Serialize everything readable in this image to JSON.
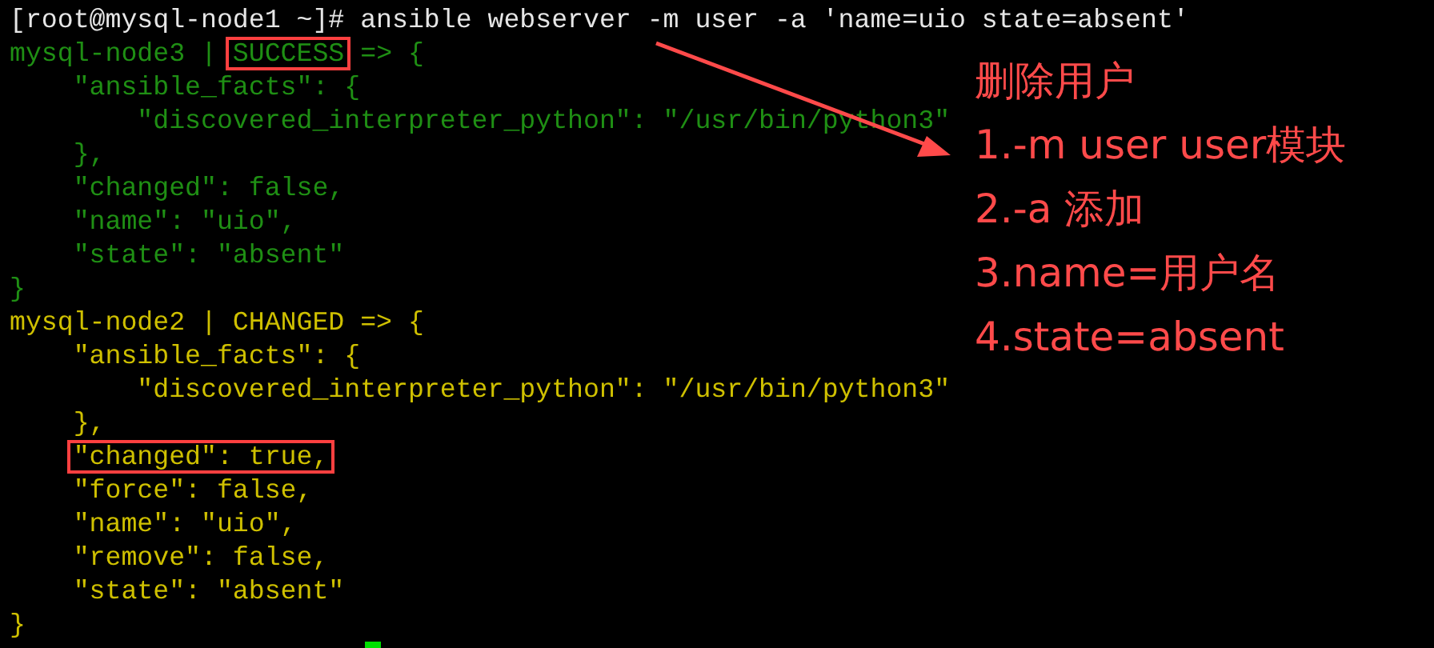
{
  "terminal": {
    "lines": [
      {
        "kind": "prompt",
        "parts": [
          {
            "text": "[root@mysql-node1 ~]# ansible webserver -m user -a 'name=uio state=absent'",
            "boxed": false
          }
        ]
      },
      {
        "kind": "success",
        "parts": [
          {
            "text": "mysql-node3 | ",
            "boxed": false
          },
          {
            "text": "SUCCESS",
            "boxed": true
          },
          {
            "text": " => {",
            "boxed": false
          }
        ]
      },
      {
        "kind": "success",
        "parts": [
          {
            "text": "    \"ansible_facts\": {",
            "boxed": false
          }
        ]
      },
      {
        "kind": "success",
        "parts": [
          {
            "text": "        \"discovered_interpreter_python\": \"/usr/bin/python3\"",
            "boxed": false
          }
        ]
      },
      {
        "kind": "success",
        "parts": [
          {
            "text": "    },",
            "boxed": false
          }
        ]
      },
      {
        "kind": "success",
        "parts": [
          {
            "text": "    \"changed\": false,",
            "boxed": false
          }
        ]
      },
      {
        "kind": "success",
        "parts": [
          {
            "text": "    \"name\": \"uio\",",
            "boxed": false
          }
        ]
      },
      {
        "kind": "success",
        "parts": [
          {
            "text": "    \"state\": \"absent\"",
            "boxed": false
          }
        ]
      },
      {
        "kind": "success",
        "parts": [
          {
            "text": "}",
            "boxed": false
          }
        ]
      },
      {
        "kind": "changed",
        "parts": [
          {
            "text": "mysql-node2 | CHANGED => {",
            "boxed": false
          }
        ]
      },
      {
        "kind": "changed",
        "parts": [
          {
            "text": "    \"ansible_facts\": {",
            "boxed": false
          }
        ]
      },
      {
        "kind": "changed",
        "parts": [
          {
            "text": "        \"discovered_interpreter_python\": \"/usr/bin/python3\"",
            "boxed": false
          }
        ]
      },
      {
        "kind": "changed",
        "parts": [
          {
            "text": "    },",
            "boxed": false
          }
        ]
      },
      {
        "kind": "changed",
        "parts": [
          {
            "text": "    \"changed\": true,",
            "boxed": true
          }
        ]
      },
      {
        "kind": "changed",
        "parts": [
          {
            "text": "    \"force\": false,",
            "boxed": false
          }
        ]
      },
      {
        "kind": "changed",
        "parts": [
          {
            "text": "    \"name\": \"uio\",",
            "boxed": false
          }
        ]
      },
      {
        "kind": "changed",
        "parts": [
          {
            "text": "    \"remove\": false,",
            "boxed": false
          }
        ]
      },
      {
        "kind": "changed",
        "parts": [
          {
            "text": "    \"state\": \"absent\"",
            "boxed": false
          }
        ]
      },
      {
        "kind": "changed",
        "parts": [
          {
            "text": "}",
            "boxed": false
          }
        ]
      }
    ]
  },
  "annotation": {
    "title": "删除用户",
    "items": [
      "1.-m user user模块",
      "2.-a 添加",
      "3.name=用户名",
      "4.state=absent"
    ]
  }
}
